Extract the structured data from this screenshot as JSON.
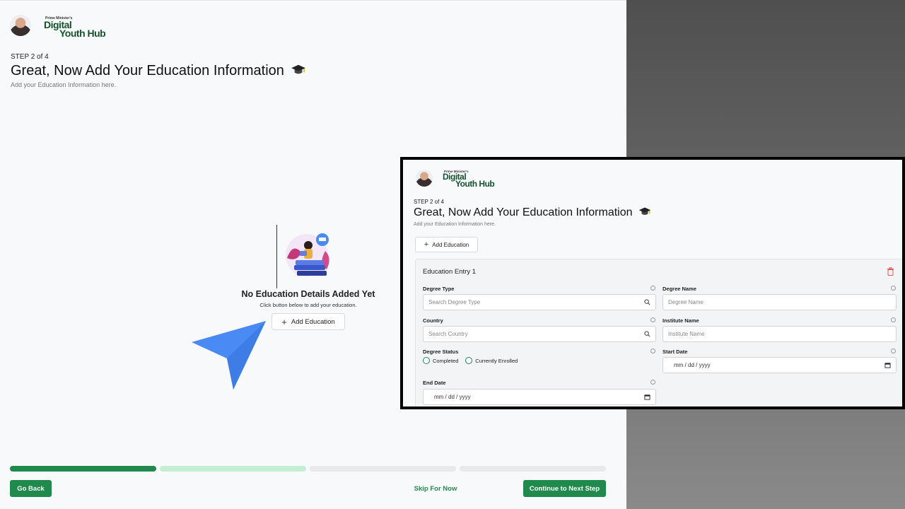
{
  "brand": {
    "logo_small": "Prime Minister's",
    "logo_line1": "Digital",
    "logo_line2": "Youth Hub"
  },
  "header": {
    "step": "STEP 2 of 4",
    "title": "Great, Now Add Your Education Information",
    "subtitle": "Add your Education Information here."
  },
  "empty_state": {
    "title": "No Education Details Added Yet",
    "subtitle": "Click button below to add your education.",
    "add_button": "Add Education"
  },
  "progress": {
    "steps_total": 4,
    "steps_completed": 1,
    "current_step": 2,
    "colors": [
      "#1f8a4c",
      "#c6efd1",
      "#e9e9e9",
      "#e9e9e9"
    ]
  },
  "footer": {
    "back": "Go Back",
    "skip": "Skip For Now",
    "next": "Continue to Next Step"
  },
  "inset": {
    "step": "STEP 2 of 4",
    "title": "Great, Now Add Your Education Information",
    "subtitle": "Add your Education Information here.",
    "add_button": "Add Education",
    "entry": {
      "title": "Education Entry 1",
      "degree_type": {
        "label": "Degree Type",
        "placeholder": "Search Degree Type"
      },
      "degree_name": {
        "label": "Degree Name",
        "placeholder": "Degree Name"
      },
      "country": {
        "label": "Country",
        "placeholder": "Search Country"
      },
      "institute_name": {
        "label": "Institute Name",
        "placeholder": "Institute Name"
      },
      "degree_status": {
        "label": "Degree Status",
        "options": [
          "Completed",
          "Currently Enrolled"
        ]
      },
      "start_date": {
        "label": "Start Date",
        "value": "mm / dd / yyyy"
      },
      "end_date": {
        "label": "End Date",
        "value": "mm / dd / yyyy"
      }
    }
  },
  "colors": {
    "accent": "#1f8a4c",
    "brand_dark": "#14532d",
    "pointer": "#4a8af4",
    "danger": "#e05555"
  }
}
